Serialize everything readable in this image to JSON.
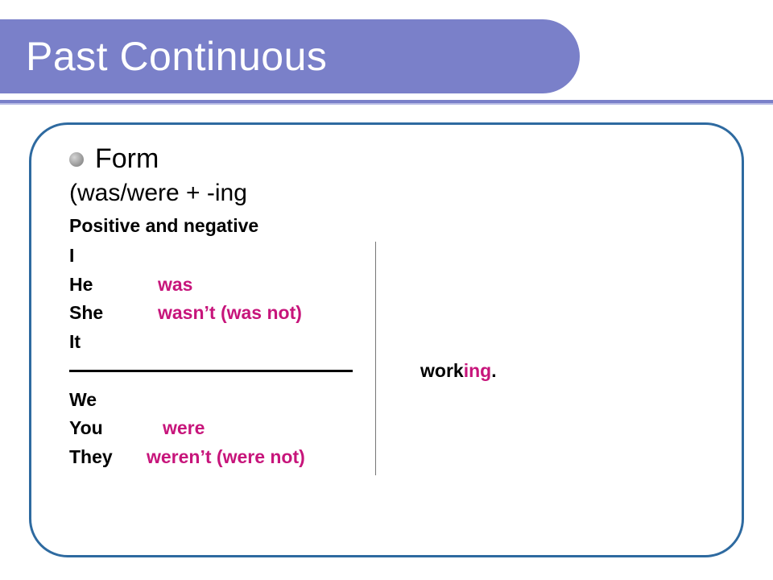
{
  "title": "Past Continuous",
  "bullet": {
    "label": "Form"
  },
  "formula": "(was/were + -ing",
  "section_label": "Positive and negative",
  "rows": {
    "i": "I",
    "he": "He",
    "she": "She",
    "it": "It",
    "we": "We",
    "you": "You",
    "they": "They"
  },
  "aux": {
    "was": "was",
    "wasnt": "wasn’t (was not)",
    "were": "were",
    "werent": "weren’t (were not)"
  },
  "verb": {
    "stem": "work",
    "suffix": "ing",
    "punct": "."
  },
  "colors": {
    "accent": "#7a80c9",
    "frame": "#2e6aa0",
    "highlight": "#c7157b"
  }
}
